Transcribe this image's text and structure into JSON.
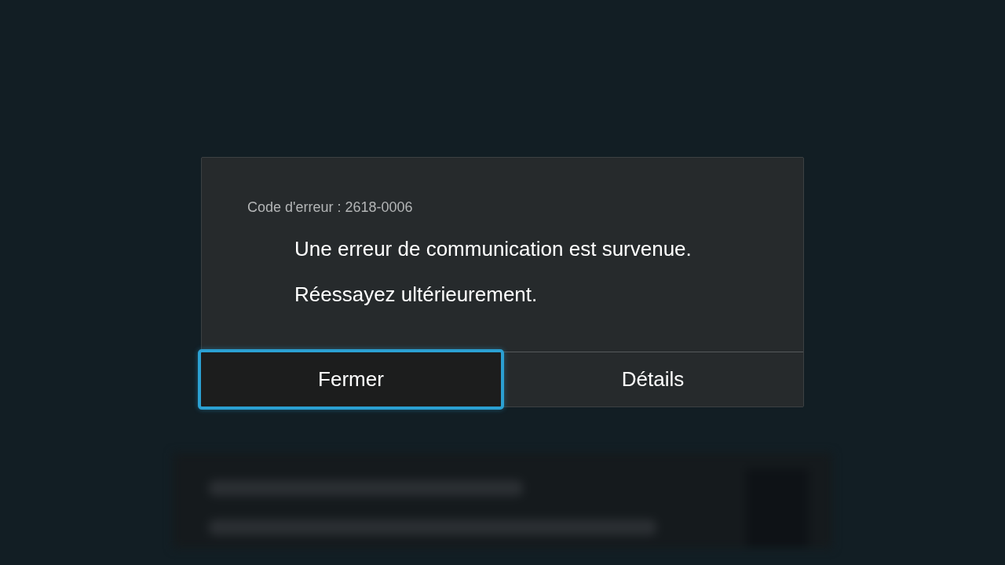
{
  "dialog": {
    "error_code": "Code d'erreur : 2618-0006",
    "message": [
      "Une erreur de communication est survenue.",
      "Réessayez ultérieurement."
    ],
    "buttons": [
      {
        "label": "Fermer",
        "selected": true
      },
      {
        "label": "Détails",
        "selected": false
      }
    ]
  }
}
